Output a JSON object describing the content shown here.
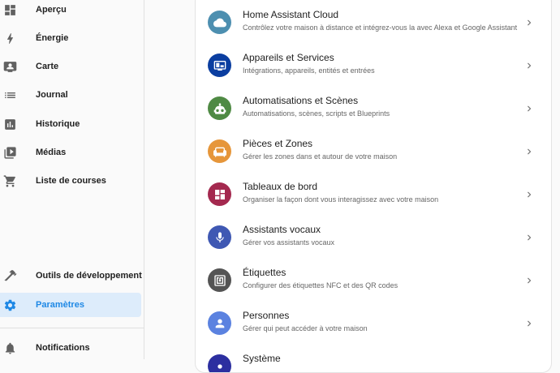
{
  "sidebar": {
    "items": [
      {
        "label": "Aperçu",
        "icon": "dashboard-icon"
      },
      {
        "label": "Énergie",
        "icon": "lightning-icon"
      },
      {
        "label": "Carte",
        "icon": "map-icon"
      },
      {
        "label": "Journal",
        "icon": "list-icon"
      },
      {
        "label": "Historique",
        "icon": "bar-chart-icon"
      },
      {
        "label": "Médias",
        "icon": "media-icon"
      },
      {
        "label": "Liste de courses",
        "icon": "cart-icon"
      }
    ],
    "bottom_items": [
      {
        "label": "Outils de développement",
        "icon": "hammer-icon"
      },
      {
        "label": "Paramètres",
        "icon": "gear-icon",
        "active": true
      }
    ],
    "notifications": {
      "label": "Notifications",
      "icon": "bell-icon"
    }
  },
  "settings": {
    "rows": [
      {
        "title": "Home Assistant Cloud",
        "description": "Contrôlez votre maison à distance et intégrez-vous la avec Alexa et Google Assistant",
        "color": "#4d8fb0",
        "icon": "cloud-lock-icon"
      },
      {
        "title": "Appareils et Services",
        "description": "Intégrations, appareils, entités et entrées",
        "color": "#0b3ea0",
        "icon": "devices-icon"
      },
      {
        "title": "Automatisations et Scènes",
        "description": "Automatisations, scènes, scripts et Blueprints",
        "color": "#4f8a44",
        "icon": "robot-icon"
      },
      {
        "title": "Pièces et Zones",
        "description": "Gérer les zones dans et autour de votre maison",
        "color": "#e6963a",
        "icon": "sofa-icon"
      },
      {
        "title": "Tableaux de bord",
        "description": "Organiser la façon dont vous interagissez avec votre maison",
        "color": "#a4294f",
        "icon": "dashboard-icon"
      },
      {
        "title": "Assistants vocaux",
        "description": "Gérer vos assistants vocaux",
        "color": "#3f58b3",
        "icon": "microphone-icon"
      },
      {
        "title": "Étiquettes",
        "description": "Configurer des étiquettes NFC et des QR codes",
        "color": "#545454",
        "icon": "nfc-tag-icon"
      },
      {
        "title": "Personnes",
        "description": "Gérer qui peut accéder à votre maison",
        "color": "#5b82e0",
        "icon": "person-icon"
      },
      {
        "title": "Système",
        "description": "",
        "color": "#2c2fa0",
        "icon": "system-icon"
      }
    ]
  }
}
